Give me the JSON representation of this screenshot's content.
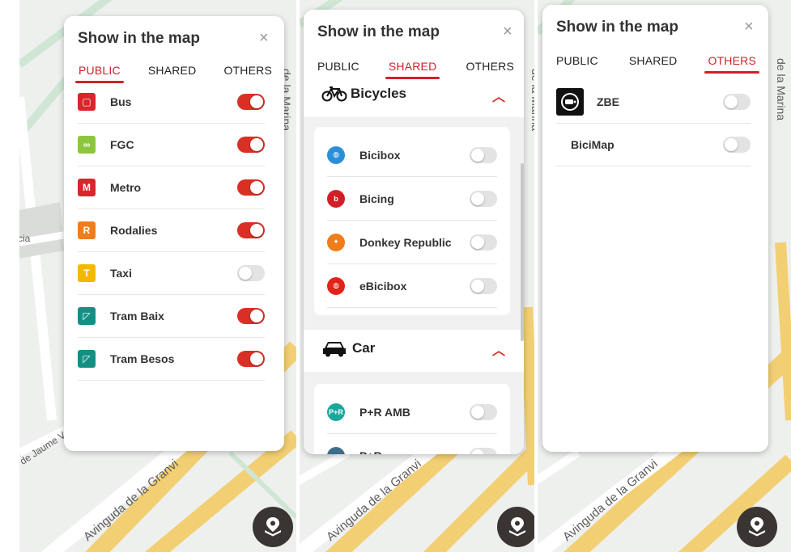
{
  "colors": {
    "accent": "#d0202a",
    "toggle_on": "#d93025",
    "toggle_off": "#e3e3e3"
  },
  "map_labels": {
    "avinguda": "Avinguda de la Granvi",
    "marina": "de la Marina",
    "jaume": "de Jaume V",
    "cia": "cia"
  },
  "panels": [
    {
      "title": "Show in the map",
      "close_icon": "×",
      "tabs": [
        "PUBLIC",
        "SHARED",
        "OTHERS"
      ],
      "active_tab": "PUBLIC",
      "items": [
        {
          "label": "Bus",
          "icon": "bus-icon",
          "color": "#d9262b",
          "glyph": "▢",
          "on": true
        },
        {
          "label": "FGC",
          "icon": "fgc-icon",
          "color": "#8cc63f",
          "glyph": "∞",
          "on": true
        },
        {
          "label": "Metro",
          "icon": "metro-icon",
          "color": "#d9262b",
          "glyph": "M",
          "on": true
        },
        {
          "label": "Rodalies",
          "icon": "rodalies-icon",
          "color": "#f07d1b",
          "glyph": "R",
          "on": true
        },
        {
          "label": "Taxi",
          "icon": "taxi-icon",
          "color": "#f5b800",
          "glyph": "T",
          "on": false
        },
        {
          "label": "Tram Baix",
          "icon": "tram-icon",
          "color": "#139083",
          "glyph": "◸",
          "on": true
        },
        {
          "label": "Tram Besos",
          "icon": "tram-icon",
          "color": "#139083",
          "glyph": "◸",
          "on": true
        }
      ]
    },
    {
      "title": "Show in the map",
      "close_icon": "×",
      "tabs": [
        "PUBLIC",
        "SHARED",
        "OTHERS"
      ],
      "active_tab": "SHARED",
      "sections": [
        {
          "title": "Bicycles",
          "icon": "bicycle-icon",
          "items": [
            {
              "label": "Bicibox",
              "icon": "bicibox-icon",
              "color": "#2b8fd8",
              "glyph": "◍",
              "on": false
            },
            {
              "label": "Bicing",
              "icon": "bicing-icon",
              "color": "#d21f26",
              "glyph": "b",
              "on": false
            },
            {
              "label": "Donkey Republic",
              "icon": "donkey-icon",
              "color": "#ef7d1a",
              "glyph": "✦",
              "on": false
            },
            {
              "label": "eBicibox",
              "icon": "ebicibox-icon",
              "color": "#e2231a",
              "glyph": "◍",
              "on": false
            }
          ]
        },
        {
          "title": "Car",
          "icon": "car-icon",
          "items": [
            {
              "label": "P+R AMB",
              "icon": "park-ride-icon",
              "color": "#1aa89d",
              "glyph": "P+R",
              "on": false
            },
            {
              "label": "P+R",
              "icon": "park-ride-icon",
              "color": "#3c6e88",
              "glyph": "",
              "on": false
            }
          ]
        }
      ]
    },
    {
      "title": "Show in the map",
      "close_icon": "×",
      "tabs": [
        "PUBLIC",
        "SHARED",
        "OTHERS"
      ],
      "active_tab": "OTHERS",
      "items": [
        {
          "label": "ZBE",
          "icon": "zbe-icon",
          "on": false
        },
        {
          "label": "BiciMap",
          "icon": "",
          "on": false
        }
      ]
    }
  ]
}
